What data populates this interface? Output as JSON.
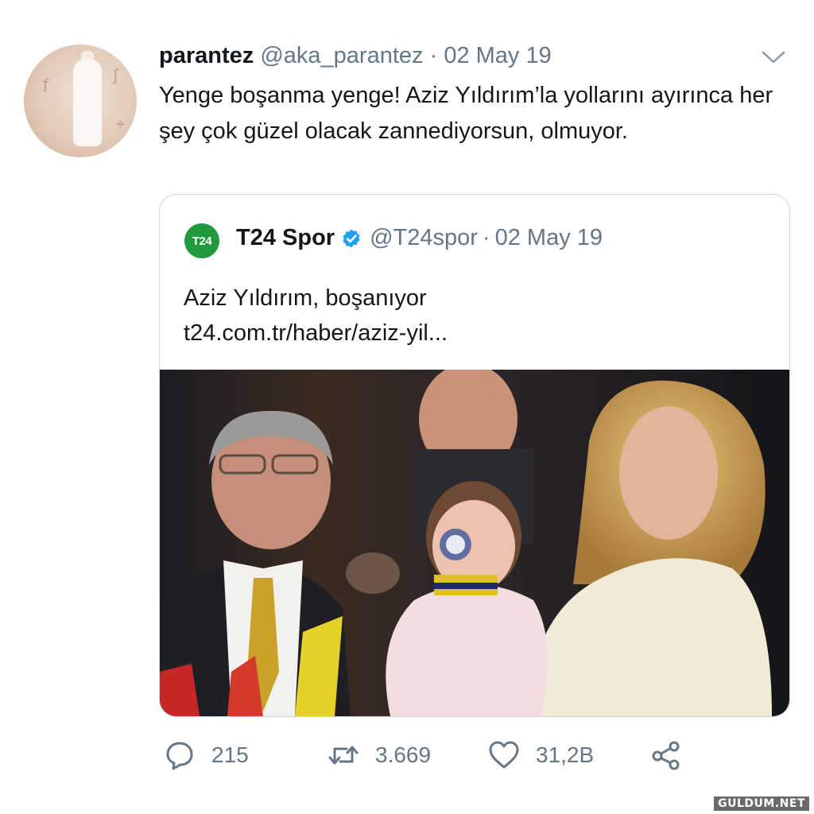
{
  "tweet": {
    "author_name": "parantez",
    "author_handle": "@aka_parantez",
    "separator": "·",
    "date": "02 May 19",
    "text": "Yenge boşanma yenge! Aziz Yıldırım’la yollarını ayırınca her şey çok güzel olacak zannediyorsun, olmuyor."
  },
  "quoted_tweet": {
    "logo_text": "T24",
    "author_name": "T24 Spor",
    "verified": true,
    "author_handle": "@T24spor",
    "separator": "·",
    "date": "02 May 19",
    "text_line1": "Aziz Yıldırım, boşanıyor",
    "link": "t24.com.tr/haber/aziz-yil..."
  },
  "actions": {
    "reply_count": "215",
    "retweet_count": "3.669",
    "like_count": "31,2B"
  },
  "icons": {
    "chevron": "chevron-down-icon",
    "reply": "reply-icon",
    "retweet": "retweet-icon",
    "like": "heart-icon",
    "share": "share-icon",
    "verified": "verified-badge-icon"
  },
  "colors": {
    "text": "#14171a",
    "secondary": "#657786",
    "verified": "#1da1f2",
    "t24_green": "#1f9b3e",
    "border": "#ccd6dd"
  },
  "watermark": "GULDUM.NET"
}
